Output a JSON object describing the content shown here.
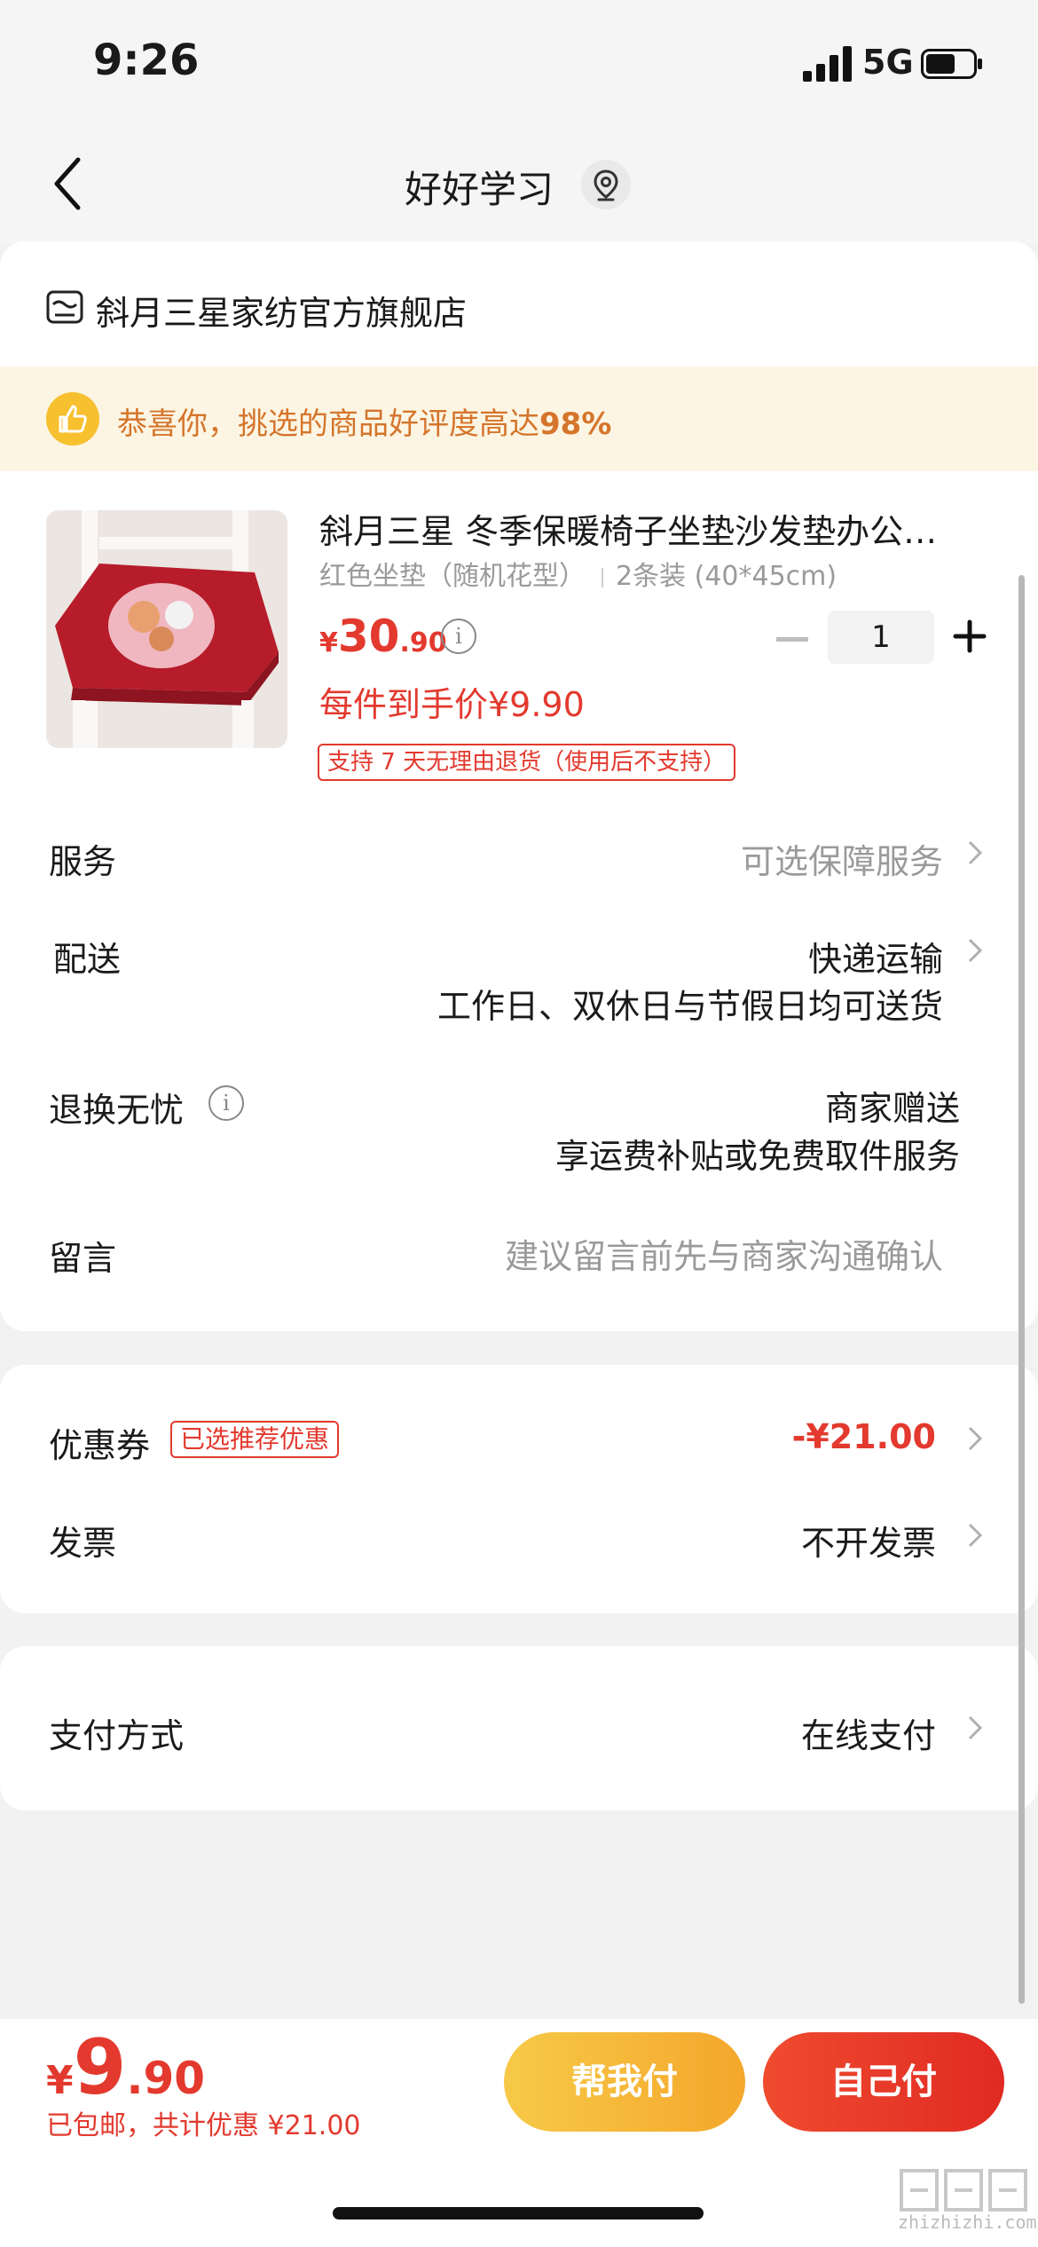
{
  "status_bar": {
    "time": "9:26",
    "network": "5G",
    "battery_level": 0.55
  },
  "header": {
    "title": "好好学习",
    "back_icon": "chevron-left-icon",
    "location_icon": "location-pin-icon"
  },
  "store": {
    "name": "斜月三星家纺官方旗舰店",
    "icon": "store-icon"
  },
  "banner": {
    "text": "恭喜你，挑选的商品好评度高达",
    "highlight": "98%",
    "icon": "thumbs-up-icon"
  },
  "product": {
    "title": "斜月三星 冬季保暖椅子坐垫沙发垫办公室椅垫",
    "variant": "红色坐垫（随机花型）",
    "pack": "2条装 (40*45cm)",
    "price_symbol": "¥",
    "price_int": "30",
    "price_dec": ".90",
    "quantity": "1",
    "unit_price": "每件到手价¥9.90",
    "policy": "支持 7 天无理由退货（使用后不支持）"
  },
  "rows": {
    "service": {
      "label": "服务",
      "value": "可选保障服务"
    },
    "delivery": {
      "label": "配送",
      "value": "快递运输",
      "sub": "工作日、双休日与节假日均可送货"
    },
    "returns": {
      "label": "退换无忧",
      "value": "商家赠送",
      "sub": "享运费补贴或免费取件服务"
    },
    "message": {
      "label": "留言",
      "placeholder": "建议留言前先与商家沟通确认"
    },
    "coupon": {
      "label": "优惠券",
      "tag": "已选推荐优惠",
      "value": "-¥21.00"
    },
    "invoice": {
      "label": "发票",
      "value": "不开发票"
    },
    "payment": {
      "label": "支付方式",
      "value": "在线支付"
    }
  },
  "footer": {
    "total_symbol": "¥",
    "total_int": "9",
    "total_dec": ".90",
    "note": "已包邮，共计优惠 ¥21.00",
    "help_pay": "帮我付",
    "self_pay": "自己付"
  },
  "watermark": {
    "text": "zhizhizhi.com"
  },
  "colors": {
    "accent_red": "#e3392e",
    "banner_bg": "#fcf5e3",
    "banner_text": "#d5752b",
    "help_button": "#f4b33a",
    "self_button": "#e8382a"
  }
}
